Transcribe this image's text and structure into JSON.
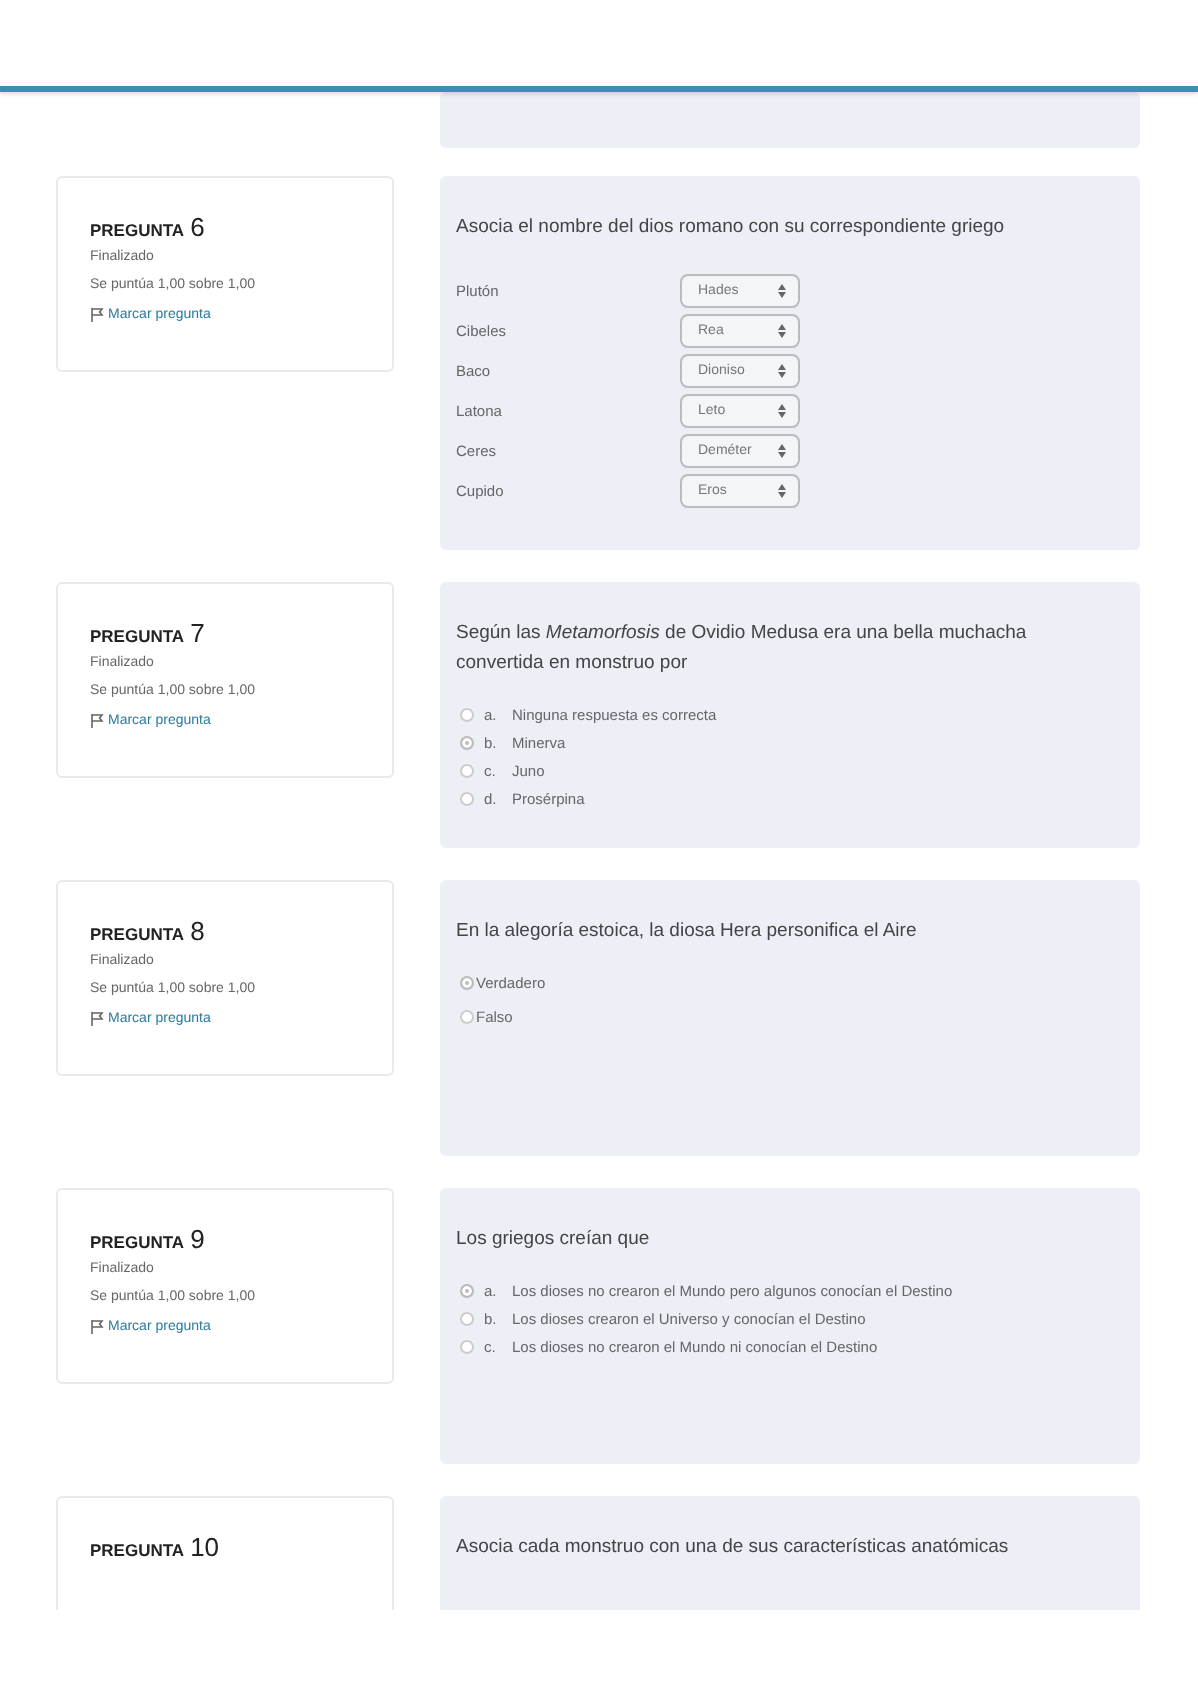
{
  "questions": [
    {
      "heading": "PREGUNTA",
      "number": "6",
      "state": "Finalizado",
      "grade": "Se puntúa 1,00 sobre 1,00",
      "flag": "Marcar pregunta",
      "kind": "match",
      "text": "Asocia el nombre del dios romano con su correspondiente griego",
      "pairs": [
        {
          "label": "Plutón",
          "value": "Hades"
        },
        {
          "label": "Cibeles",
          "value": "Rea"
        },
        {
          "label": "Baco",
          "value": "Dioniso"
        },
        {
          "label": "Latona",
          "value": "Leto"
        },
        {
          "label": "Ceres",
          "value": "Deméter"
        },
        {
          "label": "Cupido",
          "value": "Eros"
        }
      ]
    },
    {
      "heading": "PREGUNTA",
      "number": "7",
      "state": "Finalizado",
      "grade": "Se puntúa 1,00 sobre 1,00",
      "flag": "Marcar pregunta",
      "kind": "choice",
      "text": "Según las *Metamorfosis* de Ovidio Medusa era una bella muchacha convertida en monstruo por",
      "options": [
        {
          "letter": "a.",
          "text": "Ninguna respuesta es correcta",
          "selected": false
        },
        {
          "letter": "b.",
          "text": "Minerva",
          "selected": true
        },
        {
          "letter": "c.",
          "text": "Juno",
          "selected": false
        },
        {
          "letter": "d.",
          "text": "Prosérpina",
          "selected": false
        }
      ]
    },
    {
      "heading": "PREGUNTA",
      "number": "8",
      "state": "Finalizado",
      "grade": "Se puntúa 1,00 sobre 1,00",
      "flag": "Marcar pregunta",
      "kind": "choice",
      "text": "En la alegoría estoica, la diosa Hera personifica el Aire",
      "options": [
        {
          "text": "Verdadero",
          "selected": true
        },
        {
          "text": "Falso",
          "selected": false
        }
      ]
    },
    {
      "heading": "PREGUNTA",
      "number": "9",
      "state": "Finalizado",
      "grade": "Se puntúa 1,00 sobre 1,00",
      "flag": "Marcar pregunta",
      "kind": "choice",
      "text": "Los griegos creían que",
      "options": [
        {
          "letter": "a.",
          "text": "Los dioses no crearon el Mundo pero algunos conocían el Destino",
          "selected": true
        },
        {
          "letter": "b.",
          "text": "Los dioses crearon el Universo y conocían el Destino",
          "selected": false
        },
        {
          "letter": "c.",
          "text": "Los dioses no crearon el Mundo ni conocían el Destino",
          "selected": false
        }
      ]
    },
    {
      "heading": "PREGUNTA",
      "number": "10",
      "kind": "match",
      "text": "Asocia cada monstruo con una de sus características anatómicas"
    }
  ]
}
